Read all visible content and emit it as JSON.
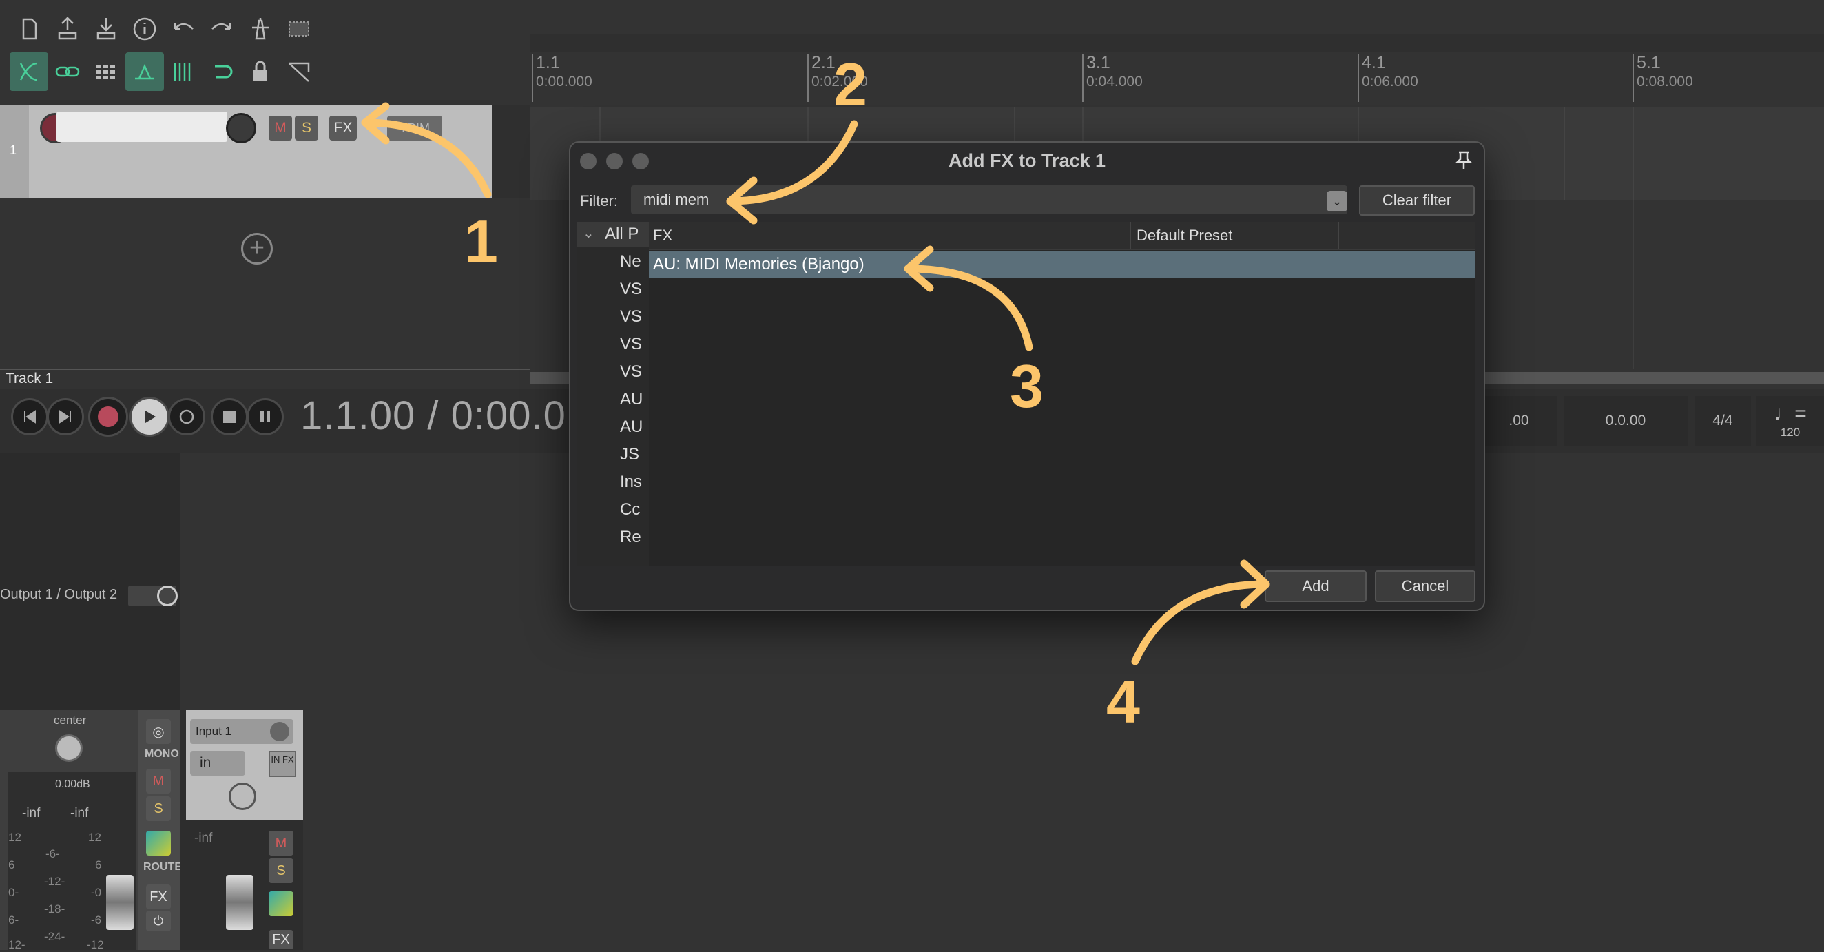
{
  "toolbar": {
    "row1_icons": [
      "new-project-icon",
      "save-icon",
      "load-icon",
      "info-icon",
      "undo-icon",
      "redo-icon",
      "metronome-icon",
      "marquee-icon"
    ],
    "row2_icons": [
      "ripple-edit-icon",
      "link-icon",
      "grid-icon",
      "auto-crossfade-icon",
      "snap-icon",
      "loop-icon",
      "lock-icon",
      "envelope-icon"
    ]
  },
  "ruler": {
    "marks": [
      {
        "bar": "1.1",
        "time": "0:00.000"
      },
      {
        "bar": "2.1",
        "time": "0:02.000"
      },
      {
        "bar": "3.1",
        "time": "0:04.000"
      },
      {
        "bar": "4.1",
        "time": "0:06.000"
      },
      {
        "bar": "5.1",
        "time": "0:08.000"
      }
    ]
  },
  "track": {
    "number": "1",
    "mute_label": "M",
    "solo_label": "S",
    "fx_label": "FX",
    "trim_label": "TRIM",
    "name_label": "Track 1"
  },
  "transport": {
    "time": "1.1.00 / 0:00.0",
    "boxes": [
      ".00",
      "0.0.00",
      "4/4"
    ],
    "tempo": "120"
  },
  "mixer": {
    "routing": "Output 1 / Output 2",
    "pan_label": "center",
    "volume": "0.00dB",
    "peak_left": "-inf",
    "peak_right": "-inf",
    "scale_left": [
      "12",
      "6",
      "0-",
      "6-",
      "12-"
    ],
    "scale_mid": [
      "-6-",
      "-12-",
      "-18-",
      "-24-"
    ],
    "scale_right": [
      "12",
      "6",
      "-0",
      "-6",
      "-12"
    ],
    "mono_label": "MONO",
    "m_label": "M",
    "s_label": "S",
    "route_label": "ROUTE",
    "fx_label": "FX",
    "input_label": "Input 1",
    "in_label": "in",
    "in_fx_label": "IN FX",
    "input_peak": "-inf"
  },
  "dialog": {
    "title": "Add FX to Track 1",
    "filter_label": "Filter:",
    "filter_value": "midi mem",
    "clear_filter": "Clear filter",
    "tree_root": "All P",
    "tree_items": [
      "Ne",
      "VS",
      "VS",
      "VS",
      "VS",
      "AU",
      "AU",
      "JS",
      "Ins",
      "Cc",
      "Re"
    ],
    "columns": {
      "fx": "FX",
      "preset": "Default Preset"
    },
    "selected_fx": "AU: MIDI Memories (Bjango)",
    "add_label": "Add",
    "cancel_label": "Cancel"
  },
  "annotations": [
    "1",
    "2",
    "3",
    "4"
  ],
  "colors": {
    "annotation": "#fcc56b",
    "selection": "#5b6f7a",
    "toolbar_active": "#3f6e5f"
  }
}
